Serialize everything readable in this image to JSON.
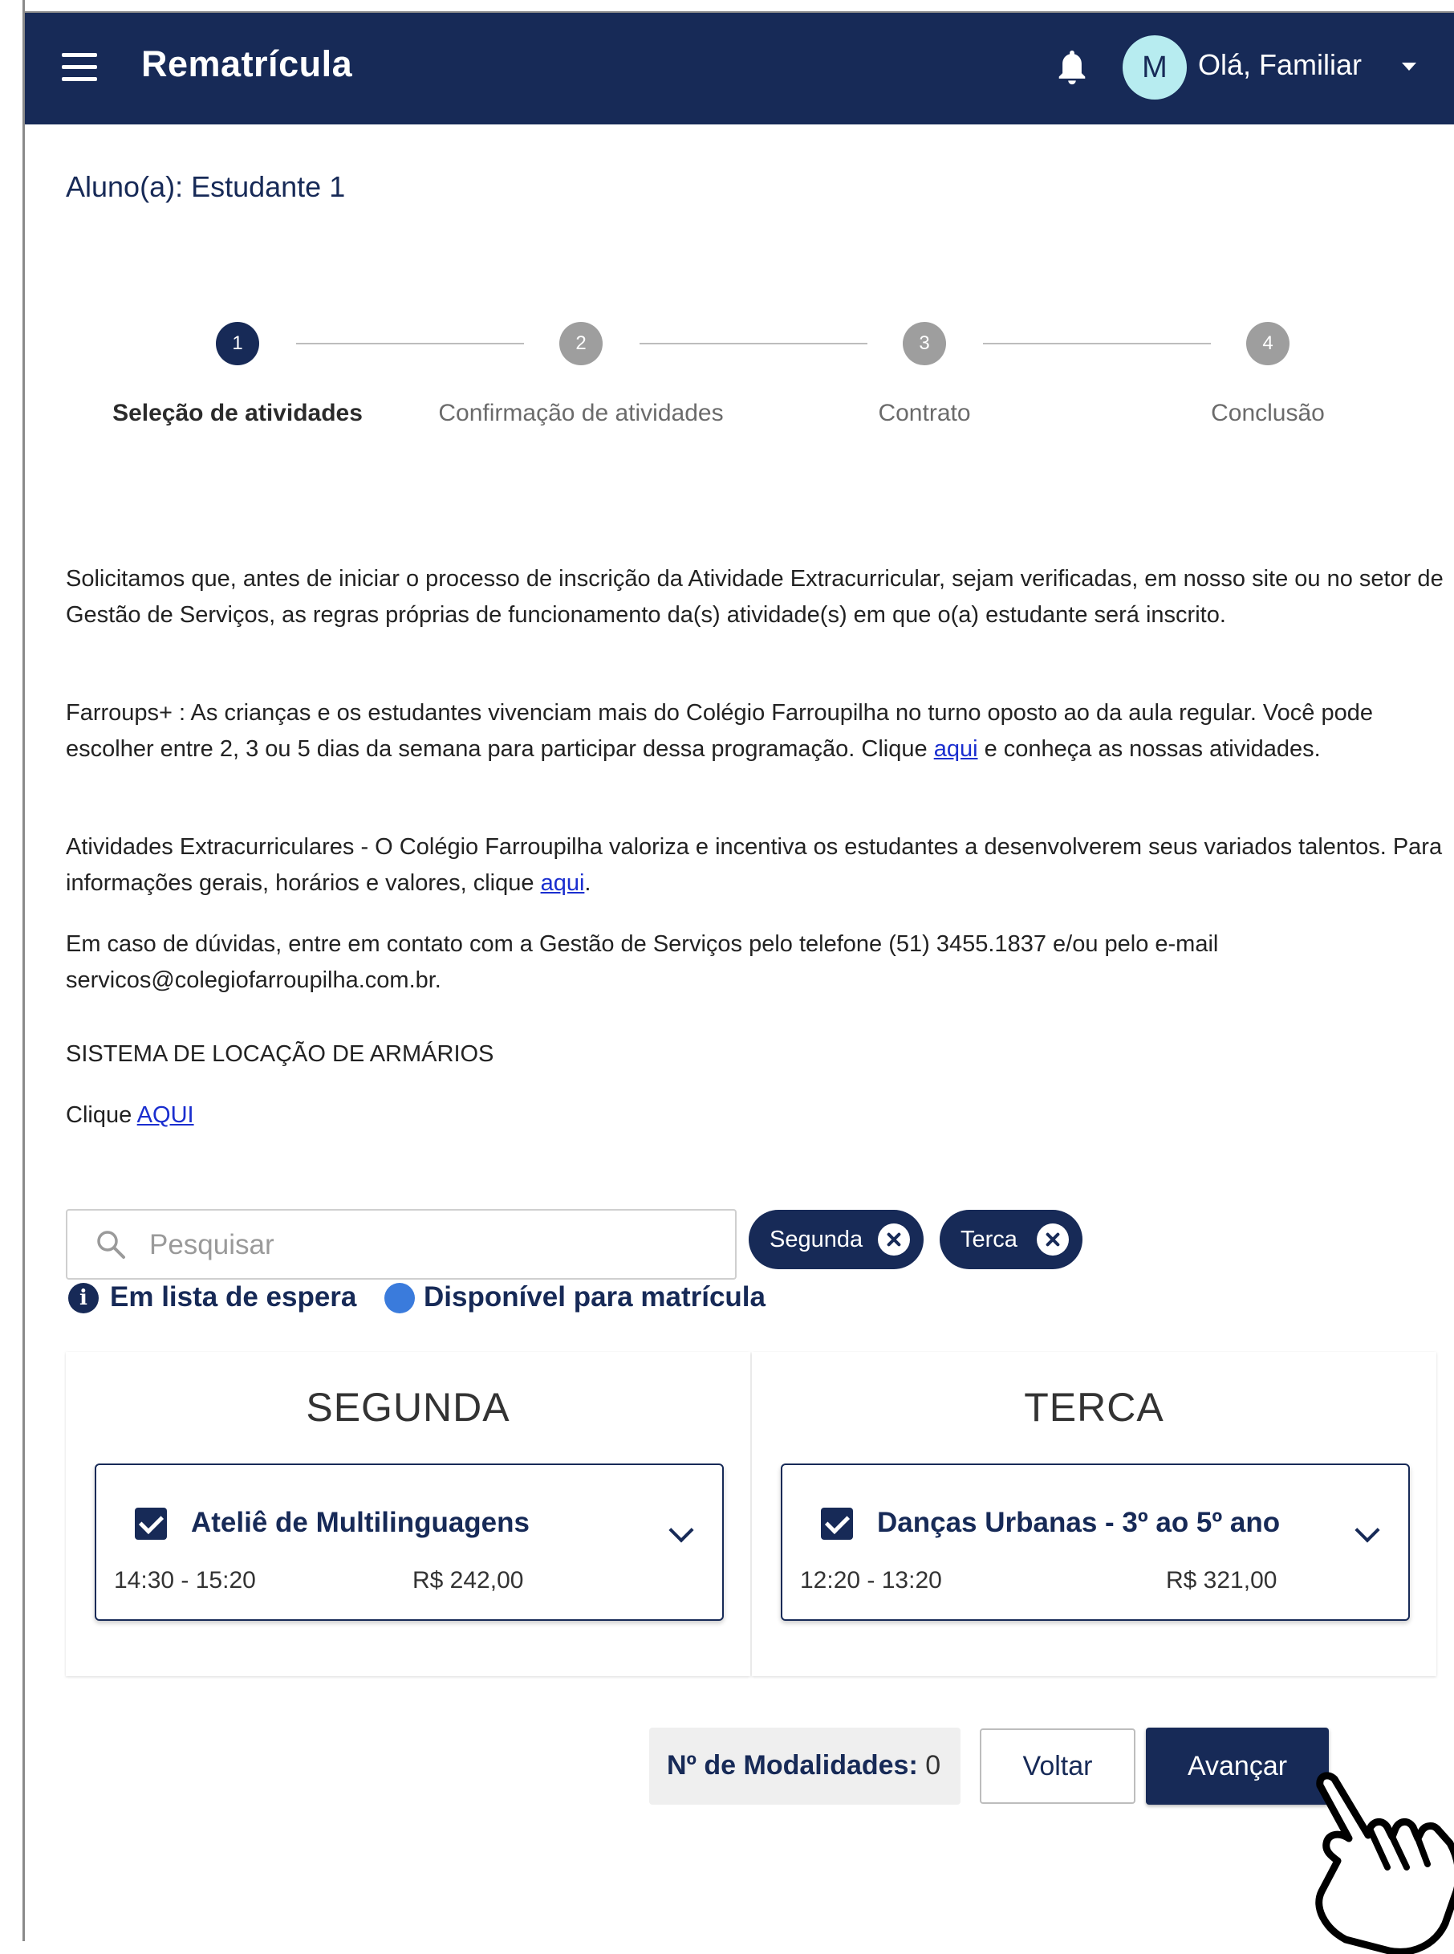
{
  "header": {
    "title": "Rematrícula",
    "avatar_initial": "M",
    "greeting": "Olá, Familiar"
  },
  "student_label": "Aluno(a): Estudante 1",
  "stepper": {
    "steps": [
      {
        "number": "1",
        "label": "Seleção de atividades",
        "state": "active"
      },
      {
        "number": "2",
        "label": "Confirmação de atividades",
        "state": "inactive"
      },
      {
        "number": "3",
        "label": "Contrato",
        "state": "inactive"
      },
      {
        "number": "4",
        "label": "Conclusão",
        "state": "inactive"
      }
    ]
  },
  "info": {
    "p1": "Solicitamos que, antes de iniciar o processo de inscrição da Atividade Extracurricular, sejam verificadas, em nosso site ou no setor de Gestão de Serviços, as regras próprias de funcionamento da(s) atividade(s) em que o(a) estudante será inscrito.",
    "p2_before": "Farroups+ : As crianças e os estudantes vivenciam mais do Colégio Farroupilha no turno oposto ao da aula regular. Você pode escolher entre 2, 3 ou 5 dias da semana para participar dessa programação. Clique ",
    "p2_link": "aqui",
    "p2_after": " e conheça as nossas atividades.",
    "p3_before": "Atividades Extracurriculares - O Colégio Farroupilha valoriza e incentiva os estudantes a desenvolverem seus variados talentos. Para informações gerais, horários e valores, clique ",
    "p3_link": "aqui",
    "p3_after": ".",
    "p4": "Em caso de dúvidas, entre em contato com a Gestão de Serviços pelo telefone (51) 3455.1837 e/ou pelo e-mail servicos@colegiofarroupilha.com.br.",
    "p5": "SISTEMA DE LOCAÇÃO DE ARMÁRIOS",
    "p6_before": "Clique ",
    "p6_link": "AQUI"
  },
  "search": {
    "placeholder": "Pesquisar",
    "value": ""
  },
  "filter_chips": [
    "Segunda",
    "Terca"
  ],
  "legend": {
    "waitlist": "Em lista de espera",
    "available": "Disponível para matrícula"
  },
  "columns": [
    {
      "title": "SEGUNDA",
      "card": {
        "name": "Ateliê de Multilinguagens",
        "time": "14:30 - 15:20",
        "price": "R$ 242,00",
        "checked": true
      }
    },
    {
      "title": "TERCA",
      "card": {
        "name": "Danças Urbanas - 3º ao 5º ano",
        "time": "12:20 - 13:20",
        "price": "R$ 321,00",
        "checked": true
      }
    }
  ],
  "footer": {
    "count_label": "Nº de Modalidades:",
    "count_value": "0",
    "back_label": "Voltar",
    "next_label": "Avançar"
  },
  "colors": {
    "primary": "#172a57",
    "available": "#3a7bdc",
    "avatar_bg": "#b7ecf0",
    "link": "#1a2ecf"
  },
  "icons": [
    "menu-icon",
    "bell-icon",
    "caret-down-icon",
    "search-icon",
    "close-icon",
    "info-icon",
    "chevron-down-icon",
    "pointer-hand-icon"
  ]
}
